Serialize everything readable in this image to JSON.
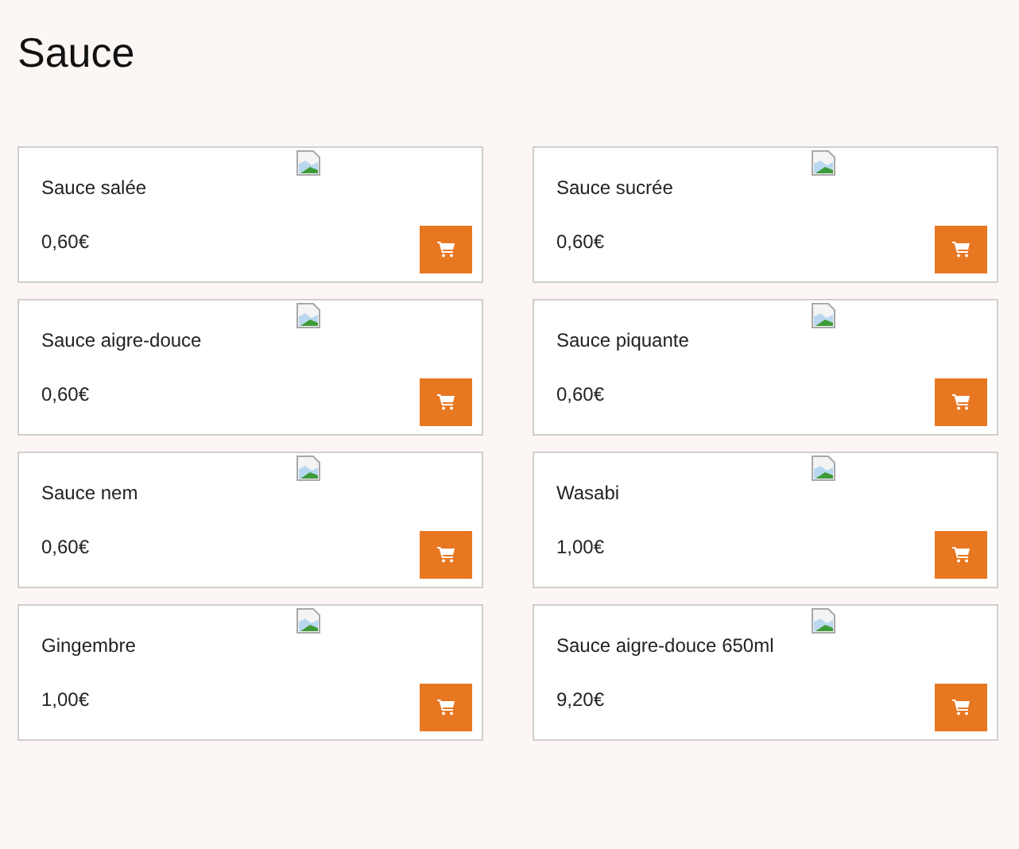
{
  "title": "Sauce",
  "products": [
    {
      "name": "Sauce salée",
      "price": "0,60€"
    },
    {
      "name": "Sauce sucrée",
      "price": "0,60€"
    },
    {
      "name": "Sauce aigre-douce",
      "price": "0,60€"
    },
    {
      "name": "Sauce piquante",
      "price": "0,60€"
    },
    {
      "name": "Sauce nem",
      "price": "0,60€"
    },
    {
      "name": "Wasabi",
      "price": "1,00€"
    },
    {
      "name": "Gingembre",
      "price": "1,00€"
    },
    {
      "name": "Sauce aigre-douce 650ml",
      "price": "9,20€"
    }
  ]
}
